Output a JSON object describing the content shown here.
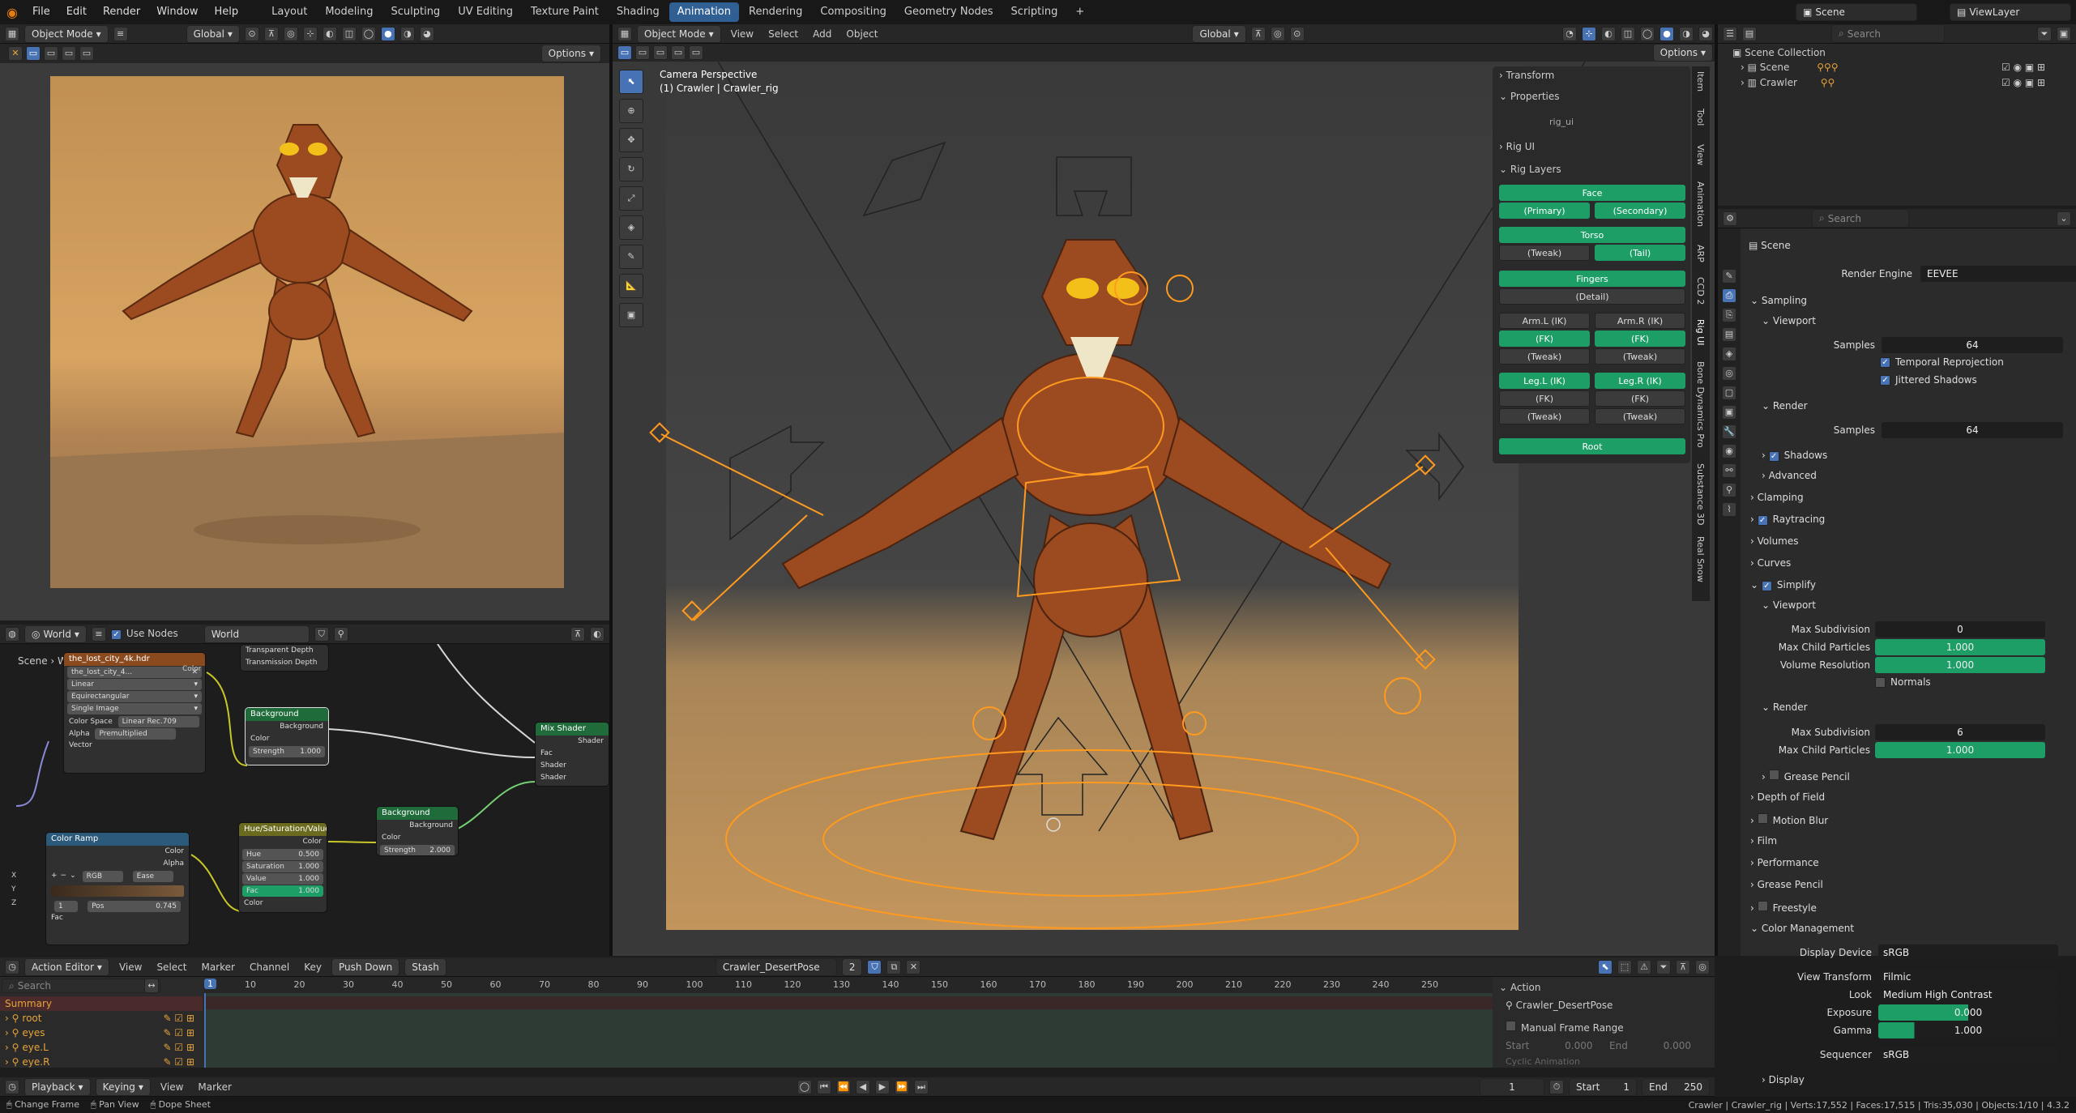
{
  "menubar": {
    "menus": [
      "File",
      "Edit",
      "Render",
      "Window",
      "Help"
    ],
    "workspaces": [
      "Layout",
      "Modeling",
      "Sculpting",
      "UV Editing",
      "Texture Paint",
      "Shading",
      "Animation",
      "Rendering",
      "Compositing",
      "Geometry Nodes",
      "Scripting"
    ],
    "active_workspace": "Animation",
    "add_tab": "+",
    "scene": "Scene",
    "view_layer": "ViewLayer"
  },
  "left_viewport": {
    "mode": "Object Mode",
    "transform": "Global",
    "options": "Options"
  },
  "node_editor": {
    "editor": "World",
    "use_nodes": "Use Nodes",
    "world": "World",
    "breadcrumb_scene": "Scene",
    "breadcrumb_world": "World",
    "env_node": {
      "title": "the_lost_city_4k.hdr",
      "image": "the_lost_city_4...",
      "interp": "Linear",
      "proj": "Equirectangular",
      "source": "Single Image",
      "color_space_label": "Color Space",
      "color_space": "Linear Rec.709",
      "alpha_label": "Alpha",
      "alpha": "Premultiplied",
      "color": "Color",
      "vector": "Vector"
    },
    "lp_node": {
      "r1": "Transparent Depth",
      "r2": "Transmission Depth"
    },
    "bg1": {
      "title": "Background",
      "out": "Background",
      "color": "Color",
      "strength_label": "Strength",
      "strength": "1.000"
    },
    "mix": {
      "title": "Mix Shader",
      "out": "Shader",
      "fac": "Fac",
      "s1": "Shader",
      "s2": "Shader"
    },
    "bg2": {
      "title": "Background",
      "out": "Background",
      "color": "Color",
      "strength_label": "Strength",
      "strength": "2.000"
    },
    "hsv": {
      "title": "Hue/Saturation/Value",
      "out": "Color",
      "hue_l": "Hue",
      "hue": "0.500",
      "sat_l": "Saturation",
      "sat": "1.000",
      "val_l": "Value",
      "val": "1.000",
      "fac_l": "Fac",
      "fac": "1.000",
      "color": "Color"
    },
    "ramp": {
      "title": "Color Ramp",
      "out_color": "Color",
      "out_alpha": "Alpha",
      "mode": "RGB",
      "interp": "Ease",
      "index": "1",
      "pos_l": "Pos",
      "pos": "0.745",
      "fac": "Fac"
    },
    "axes": [
      "X",
      "Y",
      "Z"
    ]
  },
  "main_viewport": {
    "mode": "Object Mode",
    "menus": [
      "View",
      "Select",
      "Add",
      "Object"
    ],
    "transform": "Global",
    "options": "Options",
    "cam_title": "Camera Perspective",
    "cam_sub": "(1) Crawler | Crawler_rig"
  },
  "n_panel": {
    "transform": "Transform",
    "properties": "Properties",
    "prop_value": "rig_ui",
    "rig_ui": "Rig UI",
    "rig_layers": "Rig Layers",
    "buttons": {
      "face": "Face",
      "primary": "(Primary)",
      "secondary": "(Secondary)",
      "torso": "Torso",
      "tweak1": "(Tweak)",
      "tail": "(Tail)",
      "fingers": "Fingers",
      "detail": "(Detail)",
      "arm_l_ik": "Arm.L (IK)",
      "arm_r_ik": "Arm.R (IK)",
      "arm_l_fk": "(FK)",
      "arm_r_fk": "(FK)",
      "arm_l_tw": "(Tweak)",
      "arm_r_tw": "(Tweak)",
      "leg_l_ik": "Leg.L (IK)",
      "leg_r_ik": "Leg.R (IK)",
      "leg_l_fk": "(FK)",
      "leg_r_fk": "(FK)",
      "leg_l_tw": "(Tweak)",
      "leg_r_tw": "(Tweak)",
      "root": "Root"
    },
    "tabs": [
      "Item",
      "Tool",
      "View",
      "Animation",
      "ARP",
      "CCD 2",
      "Rig UI",
      "Bone Dynamics Pro",
      "Substance 3D",
      "Real Snow"
    ]
  },
  "outliner": {
    "search": "Search",
    "collection": "Scene Collection",
    "items": [
      "Scene",
      "Crawler"
    ]
  },
  "properties": {
    "search": "Search",
    "context": "Scene",
    "render_engine_label": "Render Engine",
    "render_engine": "EEVEE",
    "sampling": "Sampling",
    "viewport": "Viewport",
    "samples_label": "Samples",
    "viewport_samples": "64",
    "temporal": "Temporal Reprojection",
    "jittered": "Jittered Shadows",
    "render": "Render",
    "render_samples": "64",
    "shadows": "Shadows",
    "advanced": "Advanced",
    "clamping": "Clamping",
    "raytracing": "Raytracing",
    "volumes": "Volumes",
    "curves": "Curves",
    "simplify": "Simplify",
    "simp_viewport": "Viewport",
    "max_subdiv_label": "Max Subdivision",
    "max_subdiv_vp": "0",
    "max_child_label": "Max Child Particles",
    "max_child_vp": "1.000",
    "vol_res_label": "Volume Resolution",
    "vol_res": "1.000",
    "normals": "Normals",
    "simp_render": "Render",
    "max_subdiv_r": "6",
    "max_child_r": "1.000",
    "grease": "Grease Pencil",
    "dof": "Depth of Field",
    "motion_blur": "Motion Blur",
    "film": "Film",
    "performance": "Performance",
    "grease_pencil": "Grease Pencil",
    "freestyle": "Freestyle",
    "color_mgmt": "Color Management",
    "display_device_label": "Display Device",
    "display_device": "sRGB",
    "view_transform_label": "View Transform",
    "view_transform": "Filmic",
    "look_label": "Look",
    "look": "Medium High Contrast",
    "exposure_label": "Exposure",
    "exposure": "0.000",
    "gamma_label": "Gamma",
    "gamma": "1.000",
    "sequencer_label": "Sequencer",
    "sequencer": "sRGB",
    "display": "Display"
  },
  "action_editor": {
    "editor": "Action Editor",
    "menus": [
      "View",
      "Select",
      "Marker",
      "Channel",
      "Key"
    ],
    "push_down": "Push Down",
    "stash": "Stash",
    "action": "Crawler_DesertPose",
    "users": "2",
    "search": "Search",
    "channels": [
      "Summary",
      "root",
      "eyes",
      "eye.L",
      "eye.R"
    ],
    "frame_current": "1",
    "ticks": [
      "10",
      "20",
      "30",
      "40",
      "50",
      "60",
      "70",
      "80",
      "90",
      "100",
      "110",
      "120",
      "130",
      "140",
      "150",
      "160",
      "170",
      "180",
      "190",
      "200",
      "210",
      "220",
      "230",
      "240",
      "250"
    ],
    "side": {
      "title": "Action",
      "name": "Crawler_DesertPose",
      "manual": "Manual Frame Range",
      "start_l": "Start",
      "start": "0.000",
      "end_l": "End",
      "end": "0.000",
      "cyclic": "Cyclic Animation"
    }
  },
  "playback": {
    "playback": "Playback",
    "keying": "Keying",
    "view": "View",
    "marker": "Marker",
    "frame": "1",
    "start_l": "Start",
    "start": "1",
    "end_l": "End",
    "end": "250"
  },
  "statusbar": {
    "left": [
      "Change Frame",
      "Pan View",
      "Dope Sheet"
    ],
    "right": "Crawler | Crawler_rig | Verts:17,552 | Faces:17,515 | Tris:35,030 | Objects:1/10 | 4.3.2"
  },
  "colors": {
    "accent": "#4772b3",
    "green": "#1c9e66",
    "rig_orange": "#ff9a1f",
    "floor": "#c2955c"
  }
}
